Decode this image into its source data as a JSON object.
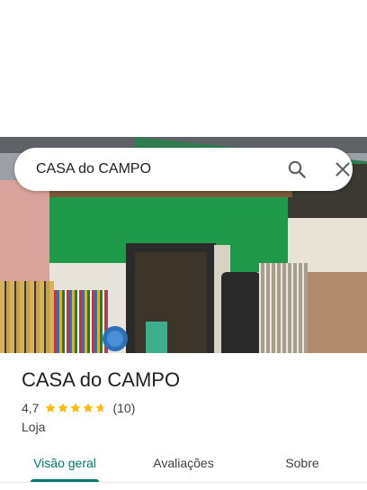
{
  "search": {
    "query": "CASA do CAMPO",
    "search_icon": "search-icon",
    "close_icon": "close-icon"
  },
  "place": {
    "name": "CASA do CAMPO",
    "rating": "4,7",
    "rating_value": 4.7,
    "review_count": "(10)",
    "category": "Loja",
    "star_color": "#fbbc04"
  },
  "tabs": [
    {
      "label": "Visão geral",
      "active": true
    },
    {
      "label": "Avaliações",
      "active": false
    },
    {
      "label": "Sobre",
      "active": false
    }
  ],
  "colors": {
    "accent": "#00796b",
    "text": "#202124",
    "secondary_text": "#3c4043"
  }
}
